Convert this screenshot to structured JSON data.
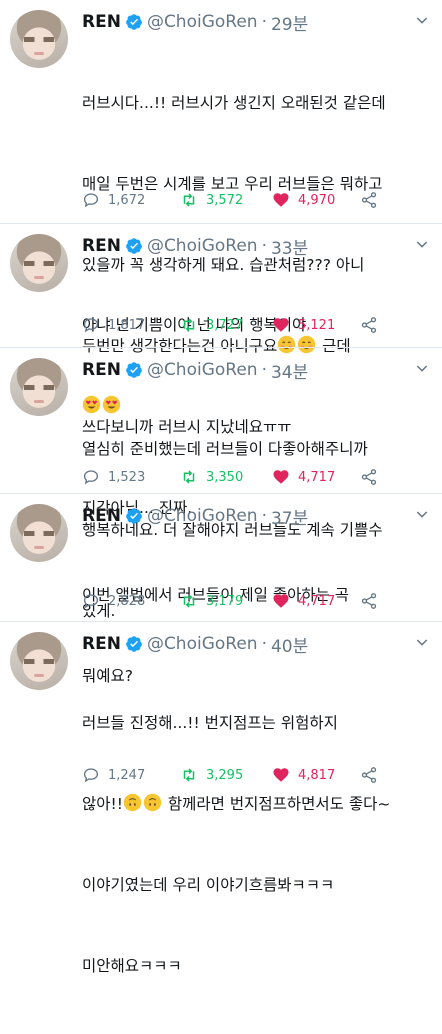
{
  "tweets": [
    {
      "name": "REN",
      "handle": "@ChoiGoRen",
      "time": "29분",
      "lines": [
        "러브시다...!! 러브시가 생긴지 오래된것 같은데",
        "매일 두번은 시계를 보고 우리 러브들은 뭐하고",
        "있을까 꼭 생각하게 돼요. 습관처럼??? 아니",
        "두번만 생각한다는건 아니구요",
        "쓰다보니까 러브시 지났네요ㅠㅠ",
        "지각아님... 진짜."
      ],
      "line4_after": " 근데",
      "replies": "1,672",
      "retweets": "3,572",
      "likes": "4,970"
    },
    {
      "name": "REN",
      "handle": "@ChoiGoRen",
      "time": "33분",
      "lines": [
        "아냐 넌 기쁨이야 넌 나의 행복이야"
      ],
      "replies": "1,817",
      "retweets": "3,727",
      "likes": "5,121"
    },
    {
      "name": "REN",
      "handle": "@ChoiGoRen",
      "time": "34분",
      "lines": [
        "열심히 준비했는데 러브들이 다좋아해주니까",
        "행복하네요. 더 잘해야지 러브들도 계속 기쁠수",
        "있게."
      ],
      "replies": "1,523",
      "retweets": "3,350",
      "likes": "4,717"
    },
    {
      "name": "REN",
      "handle": "@ChoiGoRen",
      "time": "37분",
      "lines": [
        "이번 앨범에서 러브들이 제일 좋아하는 곡",
        "뭐예요?"
      ],
      "replies": "2,828",
      "retweets": "3,179",
      "likes": "4,717"
    },
    {
      "name": "REN",
      "handle": "@ChoiGoRen",
      "time": "40분",
      "lines": [
        "러브들 진정해...!! 번지점프는 위험하지",
        "않아!!",
        "이야기였는데 우리 이야기흐름봐ㅋㅋㅋ",
        "미안해요ㅋㅋㅋ"
      ],
      "line2_after": " 함께라면 번지점프하면서도 좋다~",
      "replies": "1,247",
      "retweets": "3,295",
      "likes": "4,817"
    }
  ],
  "colors": {
    "verified": "#1da1f2",
    "retweet": "#17bf63",
    "like": "#e0245e",
    "muted": "#657786"
  },
  "icons": [
    "verified-badge-icon",
    "chevron-down-icon",
    "reply-icon",
    "retweet-icon",
    "heart-icon",
    "share-icon",
    "smiling-face-icon",
    "heart-eyes-icon",
    "upside-down-face-icon"
  ]
}
